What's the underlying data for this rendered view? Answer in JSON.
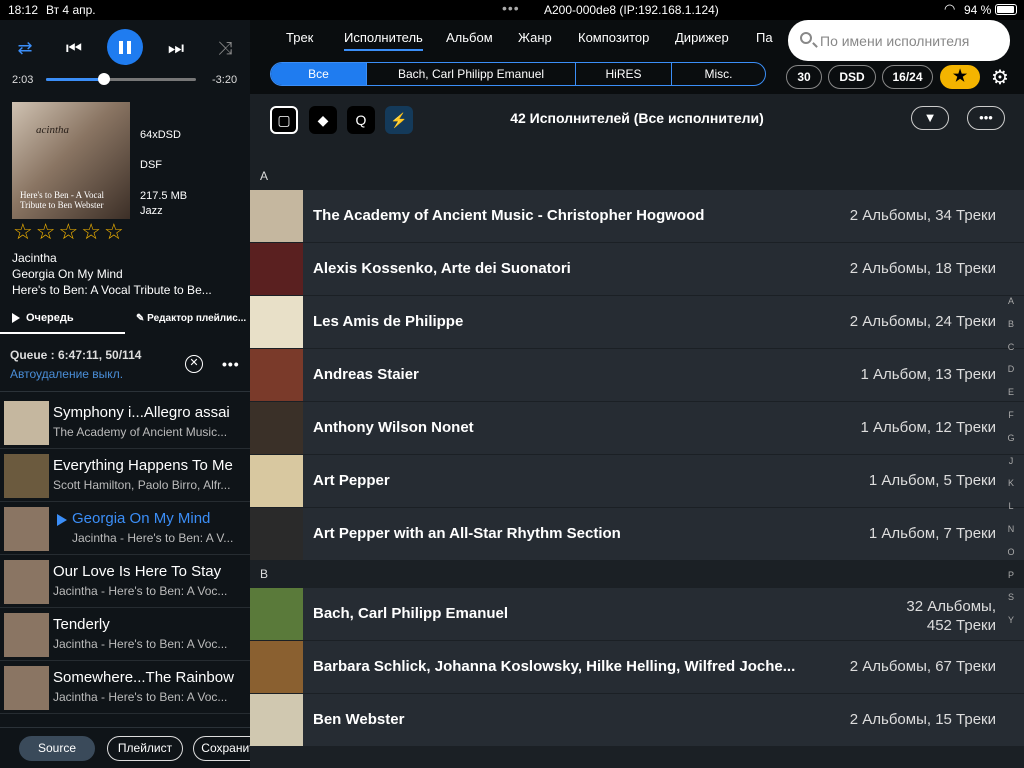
{
  "status": {
    "time": "18:12",
    "date": "Вт 4 апр.",
    "device": "A200-000de8 (IP:192.168.1.124)",
    "battery": "94 %"
  },
  "player": {
    "elapsed": "2:03",
    "remaining": "-3:20",
    "progress": 0.39,
    "cover_text_top": "acintha",
    "cover_text_bottom": "Here's to Ben - A Vocal Tribute to Ben Webster",
    "format_rate": "64xDSD",
    "format_type": "DSF",
    "size": "217.5 MB",
    "genre": "Jazz",
    "rating": 0,
    "artist": "Jacintha",
    "title": "Georgia On My Mind",
    "album": "Here's to Ben: A Vocal Tribute to Be..."
  },
  "left_tabs": {
    "queue": "Очередь",
    "editor": "Редактор плейлис..."
  },
  "queue": {
    "summary": "Queue :  6:47:11, 50/114",
    "autodelete": "Автоудаление выкл."
  },
  "queue_items": [
    {
      "title": "Symphony i...Allegro assai",
      "subtitle": "The Academy of Ancient Music...",
      "current": false,
      "color": "#c5b79f"
    },
    {
      "title": "Everything Happens To Me",
      "subtitle": "Scott Hamilton, Paolo Birro, Alfr...",
      "current": false,
      "color": "#6b5a3e"
    },
    {
      "title": "Georgia On My Mind",
      "subtitle": "Jacintha - Here's to Ben: A V...",
      "current": true,
      "color": "#8a7563"
    },
    {
      "title": "Our Love Is Here To Stay",
      "subtitle": "Jacintha - Here's to Ben: A Voc...",
      "current": false,
      "color": "#8a7563"
    },
    {
      "title": "Tenderly",
      "subtitle": "Jacintha - Here's to Ben: A Voc...",
      "current": false,
      "color": "#8a7563"
    },
    {
      "title": "Somewhere...The Rainbow",
      "subtitle": "Jacintha - Here's to Ben: A Voc...",
      "current": false,
      "color": "#8a7563"
    }
  ],
  "footer": {
    "source": "Source",
    "playlist": "Плейлист",
    "save": "Сохранит"
  },
  "nav": {
    "items": [
      "Трек",
      "Исполнитель",
      "Альбом",
      "Жанр",
      "Композитор",
      "Дирижер",
      "Па"
    ],
    "active": 1
  },
  "search": {
    "placeholder": "По имени исполнителя"
  },
  "filters": [
    "Все",
    "Bach, Carl Philipp Emanuel",
    "HiRES",
    "Misc."
  ],
  "chips": {
    "c1": "30",
    "c2": "DSD",
    "c3": "16/24",
    "star": "★"
  },
  "list_title": "42 Исполнителей (Все исполнители)",
  "sections": [
    {
      "letter": "A",
      "artists": [
        {
          "name": "The Academy of Ancient Music - Christopher Hogwood",
          "count": "2 Альбомы, 34 Треки",
          "color": "#c5b79f"
        },
        {
          "name": "Alexis Kossenko, Arte dei Suonatori",
          "count": "2 Альбомы, 18 Треки",
          "color": "#5a2020"
        },
        {
          "name": "Les Amis de Philippe",
          "count": "2 Альбомы, 24 Треки",
          "color": "#e8e0c8"
        },
        {
          "name": "Andreas Staier",
          "count": "1 Альбом, 13 Треки",
          "color": "#7a3a2a"
        },
        {
          "name": "Anthony Wilson Nonet",
          "count": "1 Альбом, 12 Треки",
          "color": "#3a3028"
        },
        {
          "name": "Art Pepper",
          "count": "1 Альбом, 5 Треки",
          "color": "#d8c8a0"
        },
        {
          "name": "Art Pepper with an All-Star Rhythm Section",
          "count": "1 Альбом, 7 Треки",
          "color": "#2a2a2a"
        }
      ]
    },
    {
      "letter": "B",
      "artists": [
        {
          "name": "Bach, Carl Philipp Emanuel",
          "count": "32 Альбомы,\n452 Треки",
          "color": "#5a7a3a"
        },
        {
          "name": "Barbara Schlick, Johanna Koslowsky, Hilke Helling, Wilfred Joche...",
          "count": "2 Альбомы, 67 Треки",
          "color": "#8a6030"
        },
        {
          "name": "Ben Webster",
          "count": "2 Альбомы, 15 Треки",
          "color": "#d0c8b0"
        }
      ]
    }
  ],
  "alphabet": [
    "A",
    "B",
    "C",
    "D",
    "E",
    "F",
    "G",
    "J",
    "K",
    "L",
    "N",
    "O",
    "P",
    "S",
    "Y"
  ],
  "colors": {
    "accent": "#1f7cf0",
    "star": "#f4b400"
  }
}
